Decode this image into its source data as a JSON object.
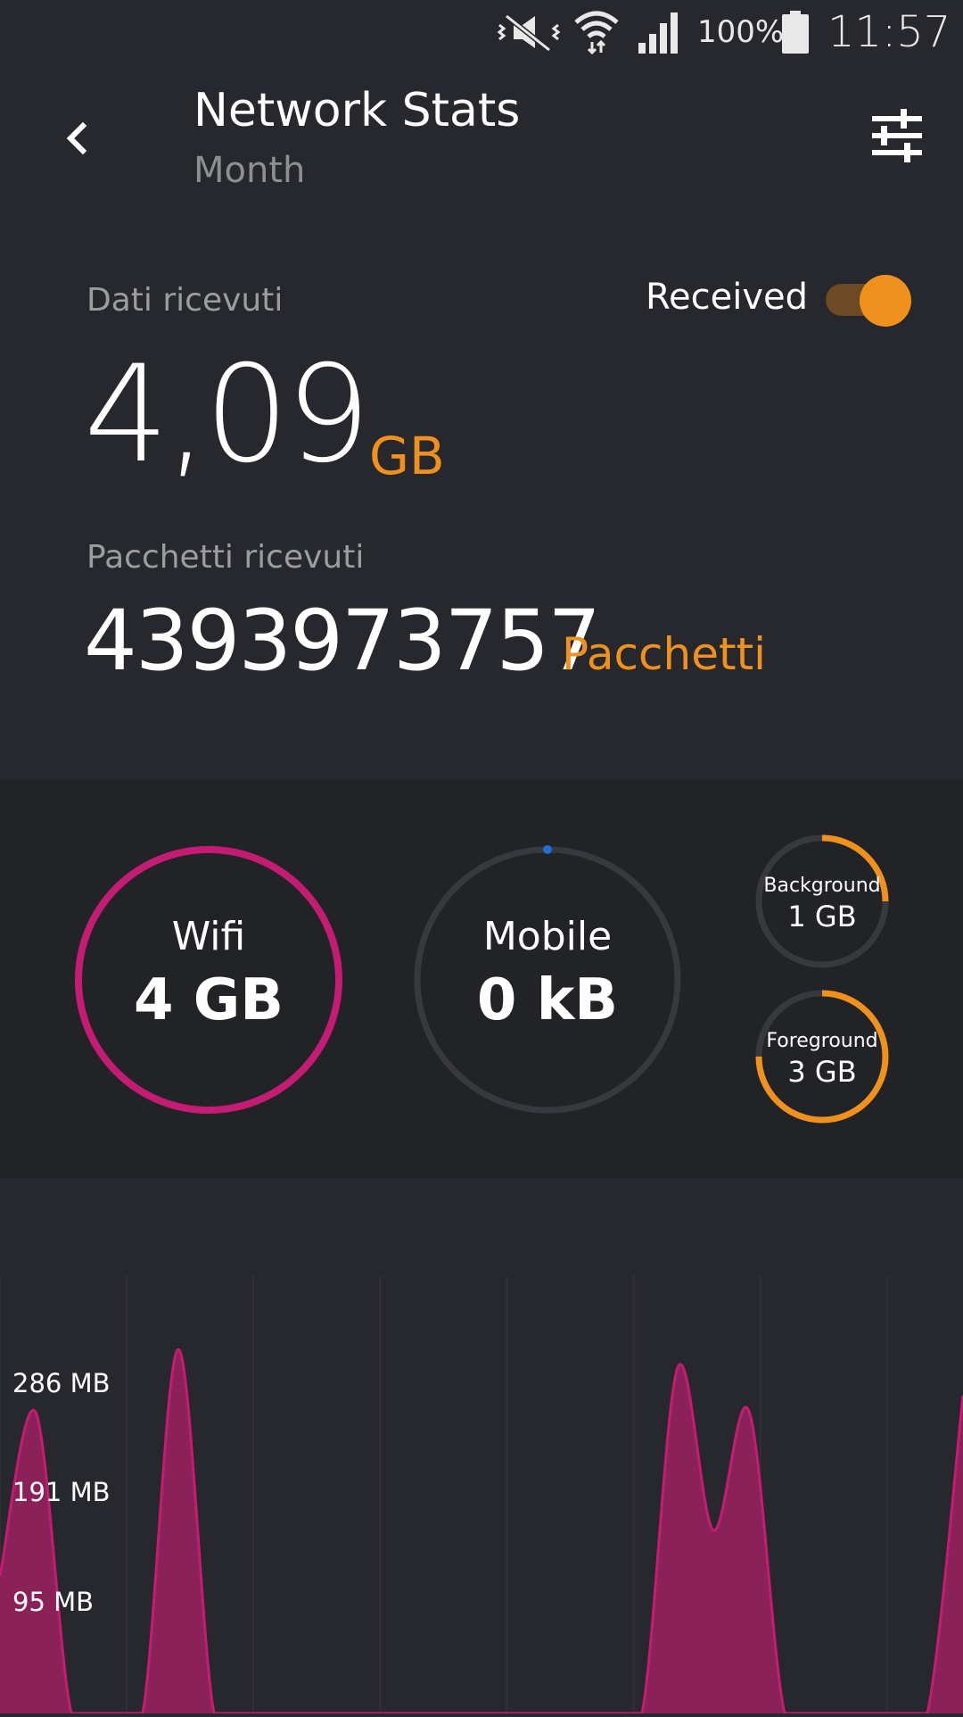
{
  "status_bar": {
    "battery_percent": "100%",
    "time": "11:57",
    "icons": [
      "mute-vibrate-icon",
      "wifi-icon",
      "signal-icon",
      "battery-icon"
    ]
  },
  "header": {
    "title": "Network Stats",
    "subtitle": "Month",
    "back_icon": "chevron-left-icon",
    "filter_icon": "sliders-icon"
  },
  "received": {
    "data_label": "Dati ricevuti",
    "data_value": "4,09",
    "data_unit": "GB",
    "toggle_label": "Received",
    "toggle_on": true,
    "packets_label": "Pacchetti ricevuti",
    "packets_value": "4393973757",
    "packets_unit": "Pacchetti"
  },
  "usage": {
    "wifi": {
      "name": "Wifi",
      "value": "4 GB",
      "fraction": 1.0,
      "color": "#c41c72"
    },
    "mobile": {
      "name": "Mobile",
      "value": "0 kB",
      "fraction": 0.0,
      "color": "#1e6fd0"
    },
    "background": {
      "name": "Background",
      "value": "1 GB",
      "fraction": 0.25,
      "color": "#f0911d"
    },
    "foreground": {
      "name": "Foreground",
      "value": "3 GB",
      "fraction": 0.75,
      "color": "#f0911d"
    }
  },
  "colors": {
    "accent": "#f0911d",
    "wifi": "#c41c72",
    "chart_fill": "#8a2159",
    "chart_stroke": "#c41c72"
  },
  "chart_data": {
    "type": "area",
    "y_tick_labels": [
      "286 MB",
      "191 MB",
      "95 MB"
    ],
    "y_ticks": [
      286,
      191,
      95
    ],
    "ylim": [
      0,
      382
    ],
    "grid": "vertical",
    "series": [
      {
        "values": [
          120,
          263,
          0,
          0,
          0,
          318,
          0,
          0,
          0,
          0,
          0,
          0,
          0,
          0,
          0,
          0,
          0,
          0,
          0,
          302,
          160,
          264,
          0,
          0,
          0,
          0,
          0,
          278
        ]
      }
    ]
  }
}
